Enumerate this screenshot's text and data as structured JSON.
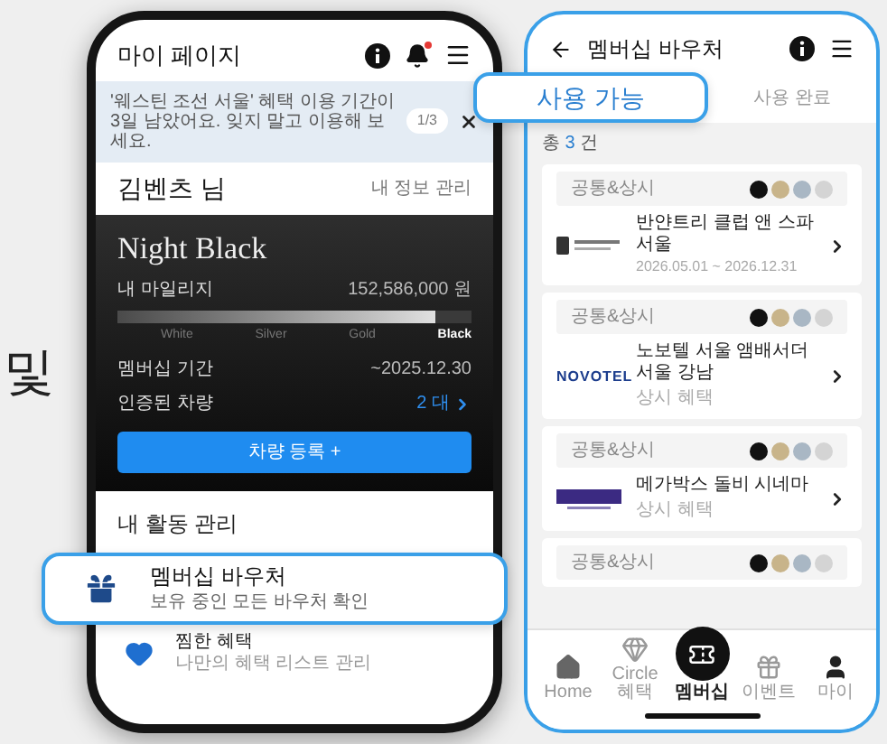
{
  "side_text": "및",
  "my_page": {
    "title": "마이 페이지",
    "notification_dot": true,
    "notice": {
      "text": "'웨스틴 조선 서울' 혜택 이용 기간이 3일 남았어요. 잊지 말고 이용해 보세요.",
      "pager": "1/3"
    },
    "user_name": "김벤츠 님",
    "profile_link": "내 정보 관리",
    "membership": {
      "tier_name": "Night Black",
      "mileage_label": "내 마일리지",
      "mileage_value": "152,586,000 원",
      "level": 0.9,
      "tiers": [
        {
          "label": "White",
          "selected": false
        },
        {
          "label": "Silver",
          "selected": false
        },
        {
          "label": "Gold",
          "selected": false
        },
        {
          "label": "Black",
          "selected": true
        }
      ],
      "rows": [
        {
          "label": "멤버십 기간",
          "value": "~2025.12.30",
          "kind": "text"
        },
        {
          "label": "인증된 차량",
          "value": "2 대",
          "kind": "link"
        }
      ],
      "register_button": "차량 등록 +"
    },
    "activity": {
      "title": "내 활동 관리",
      "items": [
        {
          "title": "멤버십 바우처",
          "subtitle": "보유 중인 모든 바우처 확인",
          "kind": "gift",
          "highlighted": true
        },
        {
          "title": "찜한 혜택",
          "subtitle": "나만의 혜택 리스트 관리",
          "kind": "heart",
          "highlighted": false
        }
      ]
    }
  },
  "voucher_page": {
    "title": "멤버십 바우처",
    "tabs": [
      {
        "label": "사용 가능",
        "selected": true
      },
      {
        "label": "사용 완료",
        "selected": false
      }
    ],
    "count": {
      "prefix": "총",
      "number": "3",
      "suffix": "건"
    },
    "vouchers": [
      {
        "category": "공통&상시",
        "badges": [
          {
            "color": "#111111"
          },
          {
            "color": "#c8b48a"
          },
          {
            "color": "#a9b7c4"
          },
          {
            "color": "#d4d4d4"
          }
        ],
        "kind": "banyan",
        "name": "반얀트리 클럽 앤 스파 서울",
        "detail": "2026.05.01 ~ 2026.12.31"
      },
      {
        "category": "공통&상시",
        "badges": [
          {
            "color": "#111111"
          },
          {
            "color": "#c8b48a"
          },
          {
            "color": "#a9b7c4"
          },
          {
            "color": "#d4d4d4"
          }
        ],
        "kind": "wordmark",
        "logo_text": "NOVOTEL",
        "name": "노보텔 서울 앰배서더 서울 강남",
        "detail": "상시 혜택"
      },
      {
        "category": "공통&상시",
        "badges": [
          {
            "color": "#111111"
          },
          {
            "color": "#c8b48a"
          },
          {
            "color": "#a9b7c4"
          },
          {
            "color": "#d4d4d4"
          }
        ],
        "kind": "block",
        "name": "메가박스 돌비 시네마",
        "detail": "상시 혜택"
      },
      {
        "category": "공통&상시",
        "badges": [
          {
            "color": "#111111"
          },
          {
            "color": "#c8b48a"
          },
          {
            "color": "#a9b7c4"
          },
          {
            "color": "#d4d4d4"
          }
        ]
      }
    ],
    "nav": [
      {
        "label": "Home",
        "kind": "home",
        "selected": false
      },
      {
        "label": "Circle 혜택",
        "kind": "gem",
        "selected": false
      },
      {
        "label": "멤버십",
        "kind": "ticket",
        "selected": true
      },
      {
        "label": "이벤트",
        "kind": "gift",
        "selected": false
      },
      {
        "label": "마이",
        "kind": "user",
        "selected": false
      }
    ]
  }
}
